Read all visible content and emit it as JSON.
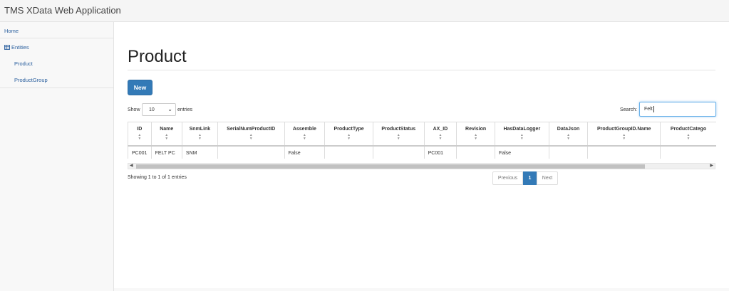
{
  "app": {
    "title": "TMS XData Web Application"
  },
  "sidebar": {
    "home_label": "Home",
    "entities_label": "Entities",
    "entities_icon": "table-icon",
    "items": [
      {
        "label": "Product"
      },
      {
        "label": "ProductGroup"
      }
    ]
  },
  "page": {
    "title": "Product",
    "new_button_label": "New"
  },
  "table_controls": {
    "show_label": "Show",
    "page_length_value": "10",
    "entries_label": "entries",
    "search_label": "Search:",
    "search_value": "Felt"
  },
  "table": {
    "columns": [
      "ID",
      "Name",
      "SnmLink",
      "SerialNumProductID",
      "Assemble",
      "ProductType",
      "ProductStatus",
      "AX_ID",
      "Revision",
      "HasDataLogger",
      "DataJson",
      "ProductGroupID.Name",
      "ProductCatego"
    ],
    "rows": [
      [
        "PC001",
        "FELT PC",
        "SNM",
        "",
        "False",
        "",
        "",
        "PC001",
        "",
        "False",
        "",
        "",
        ""
      ]
    ]
  },
  "footer": {
    "info": "Showing 1 to 1 of 1 entries",
    "previous_label": "Previous",
    "current_page": "1",
    "next_label": "Next"
  },
  "colors": {
    "primary": "#337ab7",
    "link": "#2a5f9e"
  }
}
